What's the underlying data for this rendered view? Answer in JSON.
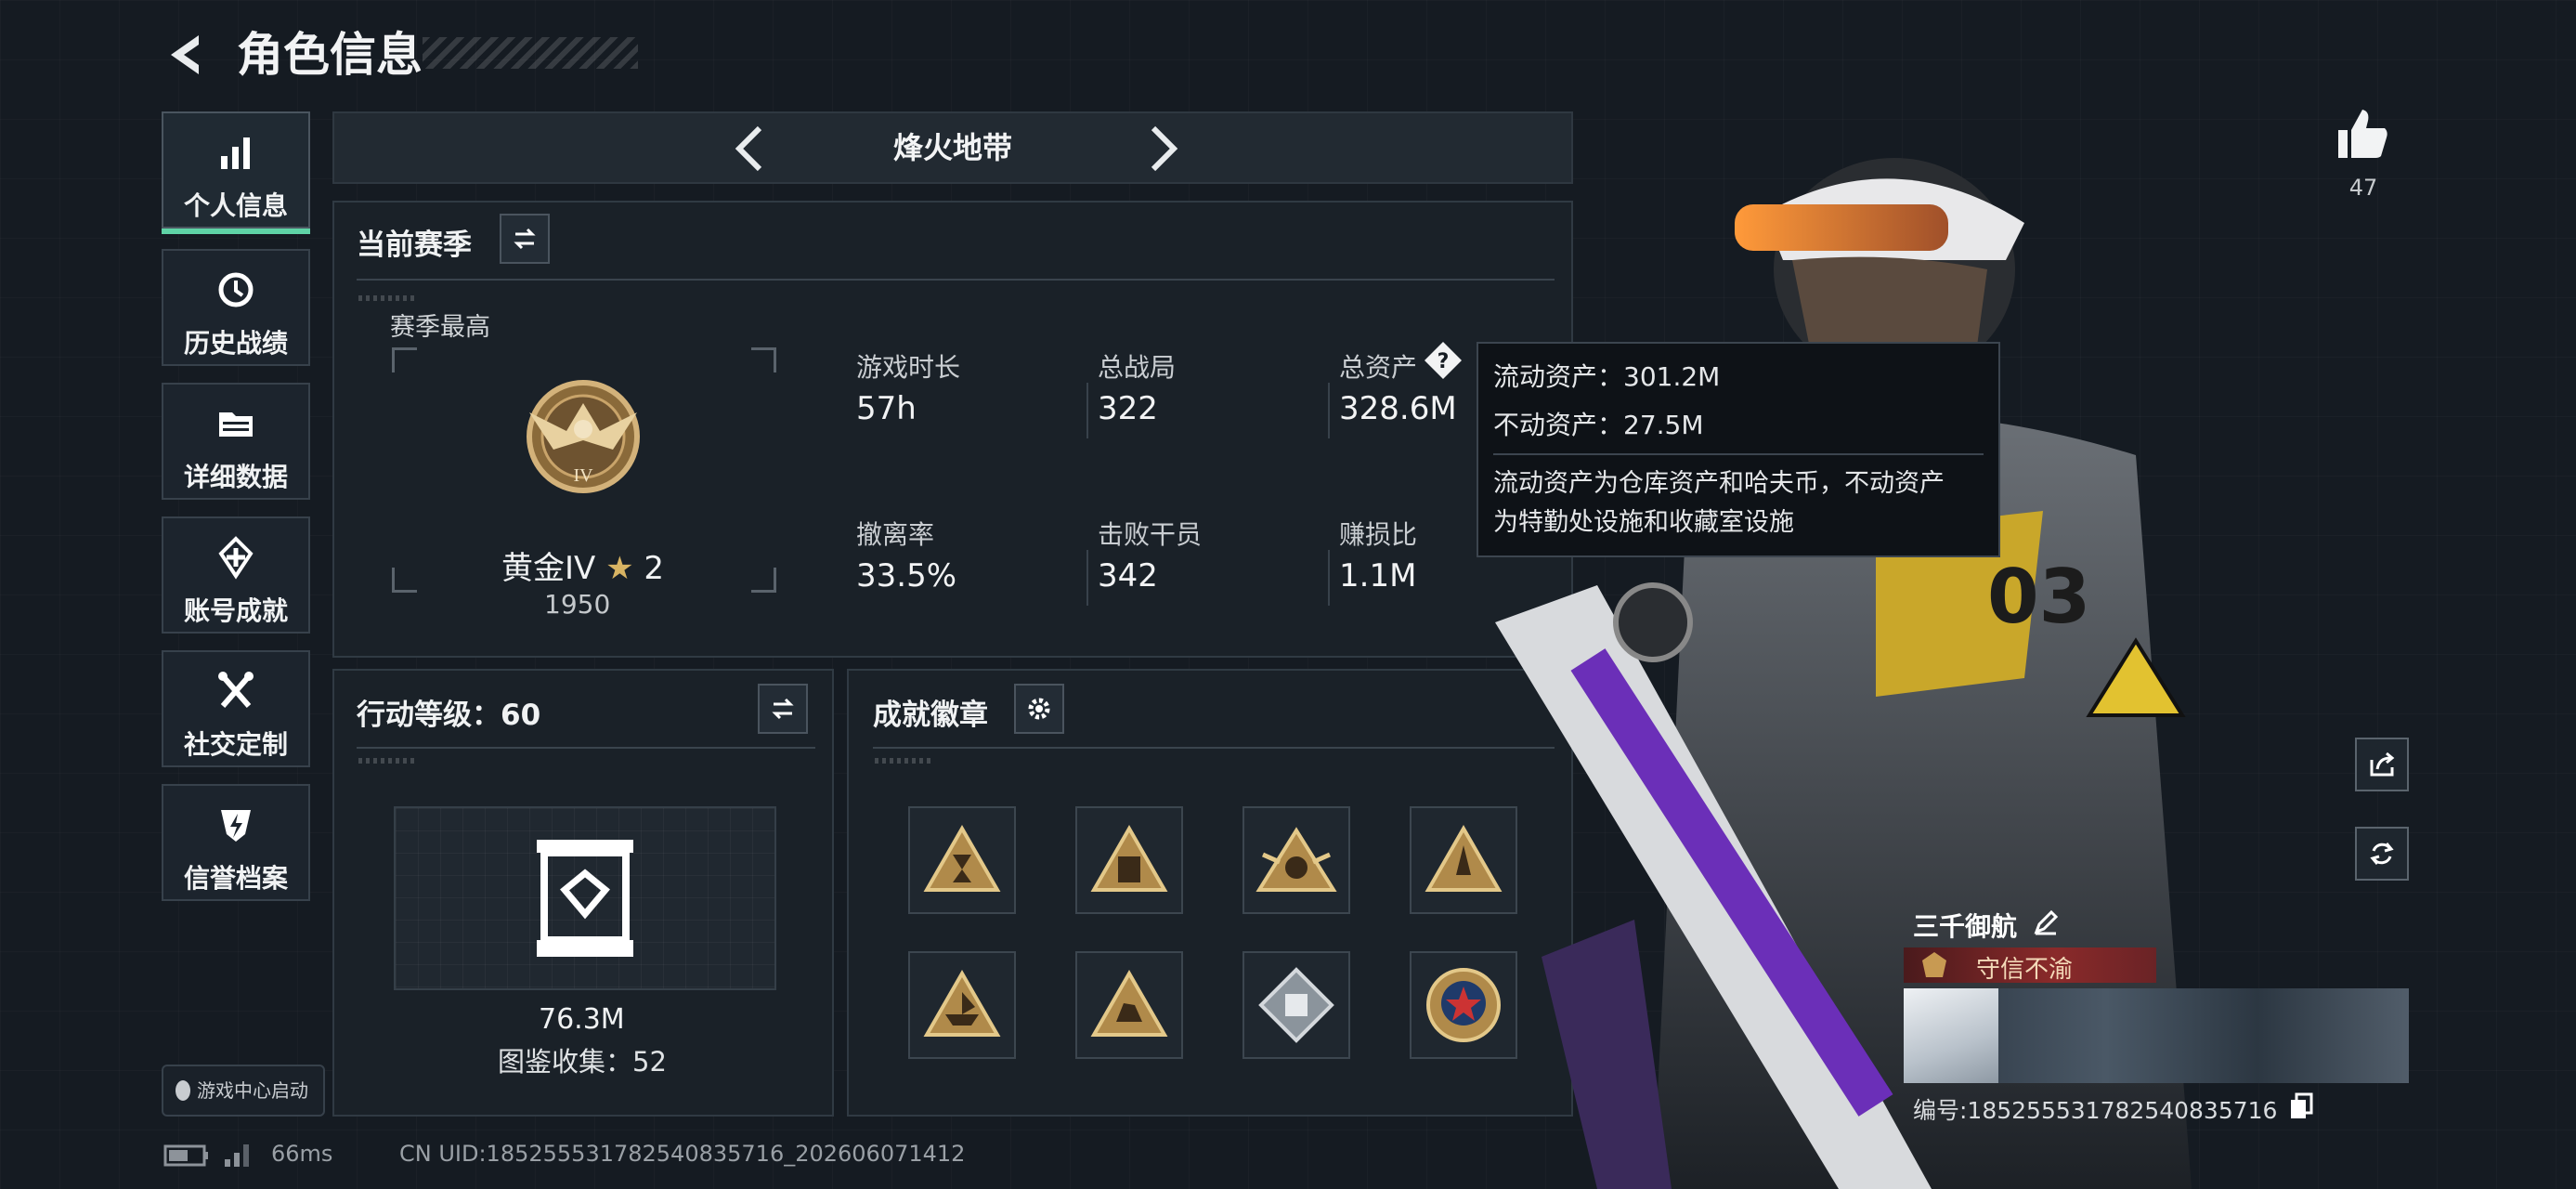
{
  "header": {
    "title": "角色信息"
  },
  "sidebar": {
    "items": [
      {
        "label": "个人信息",
        "icon": "bar-chart-icon",
        "active": true
      },
      {
        "label": "历史战绩",
        "icon": "history-icon"
      },
      {
        "label": "详细数据",
        "icon": "folder-icon"
      },
      {
        "label": "账号成就",
        "icon": "achievement-icon"
      },
      {
        "label": "社交定制",
        "icon": "tools-icon"
      },
      {
        "label": "信誉档案",
        "icon": "shield-bolt-icon"
      }
    ],
    "game_center_label": "游戏中心启动"
  },
  "mode_selector": {
    "title": "烽火地带"
  },
  "season": {
    "title": "当前赛季",
    "best_label": "赛季最高",
    "rank_name": "黄金IV",
    "rank_stars": "2",
    "rank_score": "1950",
    "rank_numeral": "IV",
    "stats": [
      {
        "label": "游戏时长",
        "value": "57h"
      },
      {
        "label": "总战局",
        "value": "322"
      },
      {
        "label": "总资产",
        "value": "328.6M"
      },
      {
        "label": "撤离率",
        "value": "33.5%"
      },
      {
        "label": "击败干员",
        "value": "342"
      },
      {
        "label": "赚损比",
        "value": "1.1M"
      }
    ]
  },
  "tooltip": {
    "liquid": "流动资产：301.2M",
    "fixed": "不动资产：27.5M",
    "desc_line1": "流动资产为仓库资产和哈夫币，不动资产",
    "desc_line2": "为特勤处设施和收藏室设施"
  },
  "action_level": {
    "title": "行动等级：60",
    "value": "76.3M",
    "collection": "图鉴收集：52"
  },
  "achievements": {
    "title": "成就徽章",
    "badges": [
      "badge-hourglass-icon",
      "badge-58-icon",
      "badge-99-icon",
      "badge-rocket-icon",
      "badge-boat-icon",
      "badge-beast-icon",
      "badge-diamond-icon",
      "badge-star-icon"
    ]
  },
  "profile": {
    "likes": "47",
    "name": "三千御航",
    "title_tag": "守信不渝",
    "id": "编号:1852555317825408357​16"
  },
  "status": {
    "ping": "66ms",
    "uid": "CN UID:1852555317825408357​16_202606071412"
  },
  "colors": {
    "accent": "#5fd3a6",
    "background": "#151b22",
    "panel": "#1a2128"
  }
}
